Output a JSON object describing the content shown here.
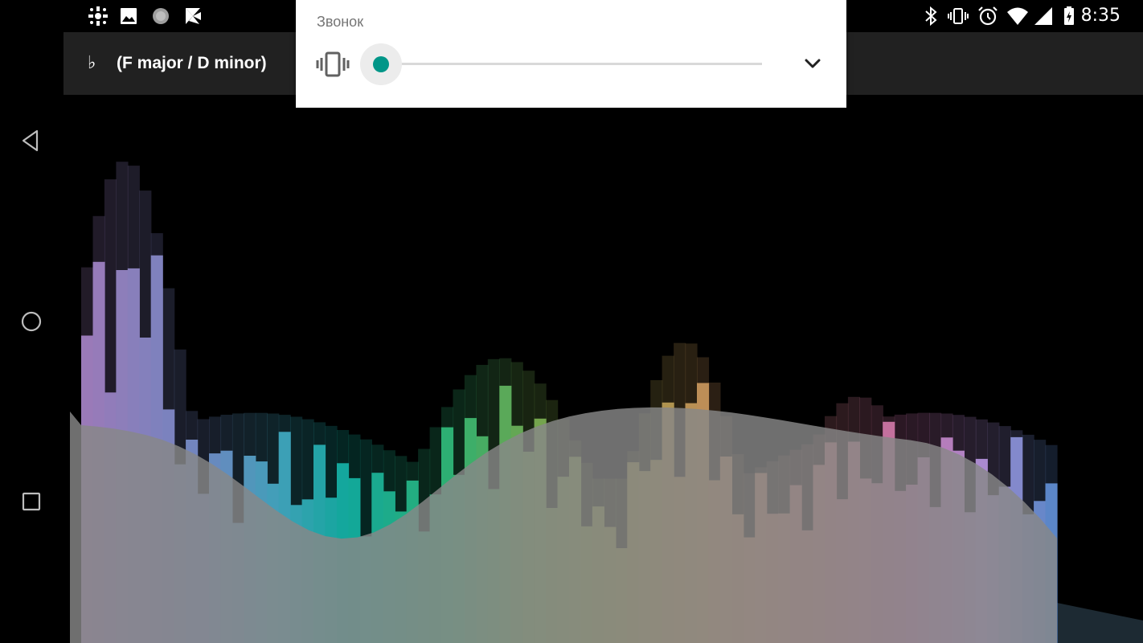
{
  "status_bar": {
    "time": "8:35",
    "left_icons": [
      "game-controller-icon",
      "image-icon",
      "circle-app-icon",
      "play-store-icon"
    ],
    "right_icons": [
      "bluetooth-icon",
      "vibrate-mode-icon",
      "alarm-icon",
      "wifi-icon",
      "signal-icon",
      "battery-icon"
    ],
    "colors": {
      "background": "#000000",
      "icon": "#ffffff"
    }
  },
  "toolbar": {
    "key_symbol": "♭",
    "key_label": "(F major / D minor)",
    "background": "#212121"
  },
  "navigation": {
    "buttons": [
      "back-icon",
      "home-icon",
      "recents-icon"
    ]
  },
  "volume_panel": {
    "title": "Звонок",
    "mode_icon": "vibrate-icon",
    "level": 0,
    "expand_icon": "chevron-down-icon",
    "accent": "#009688"
  }
}
